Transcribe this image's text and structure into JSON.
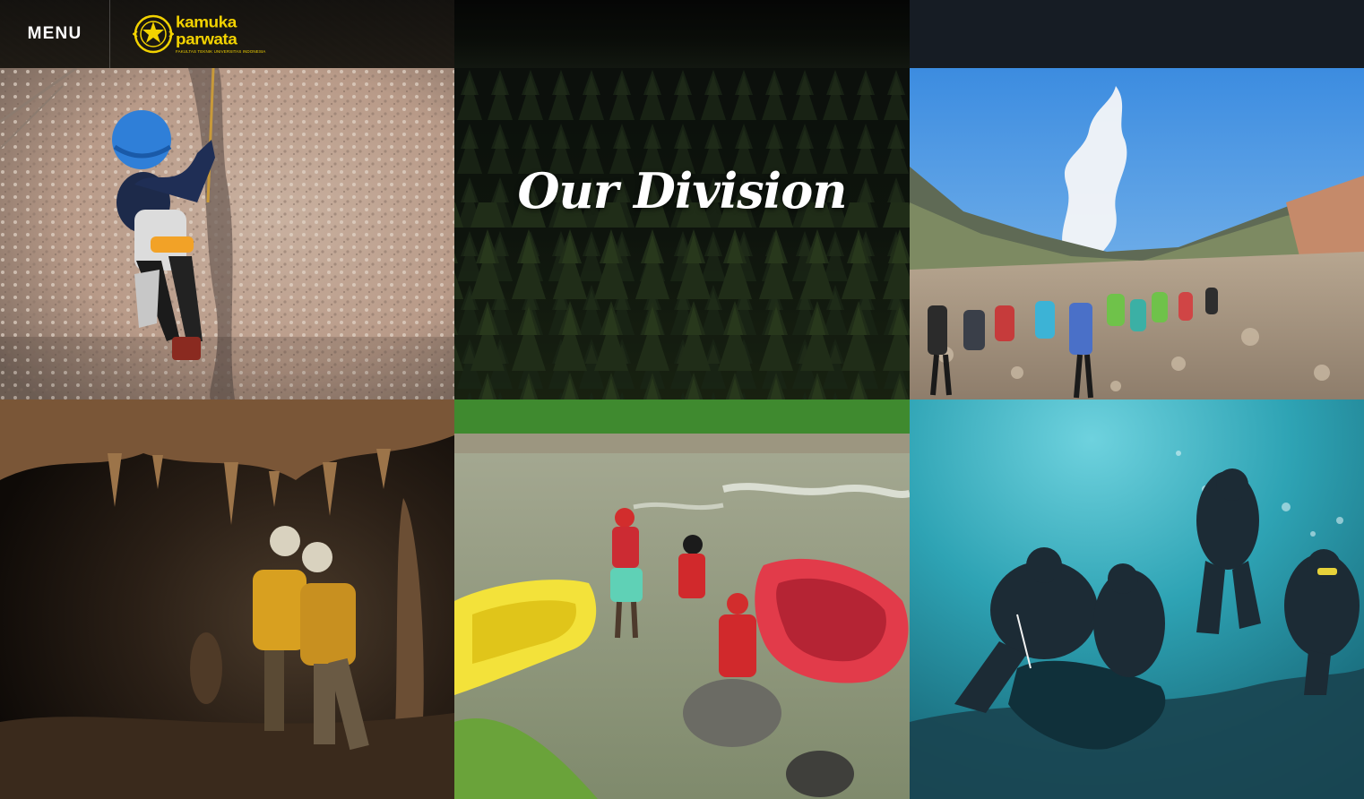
{
  "header": {
    "menu_label": "MENU",
    "logo": {
      "line1": "kamuka",
      "line2": "parwata",
      "subtitle": "FAKULTAS TEKNIK UNIVERSITAS INDONESIA",
      "color": "#f2d200"
    }
  },
  "hero": {
    "title": "Our Division"
  },
  "divisions": [
    {
      "photo": "rock-climbing"
    },
    {
      "photo": "mountain-hiking"
    },
    {
      "photo": "caving"
    },
    {
      "photo": "river-rafting"
    },
    {
      "photo": "scuba-diving"
    }
  ]
}
